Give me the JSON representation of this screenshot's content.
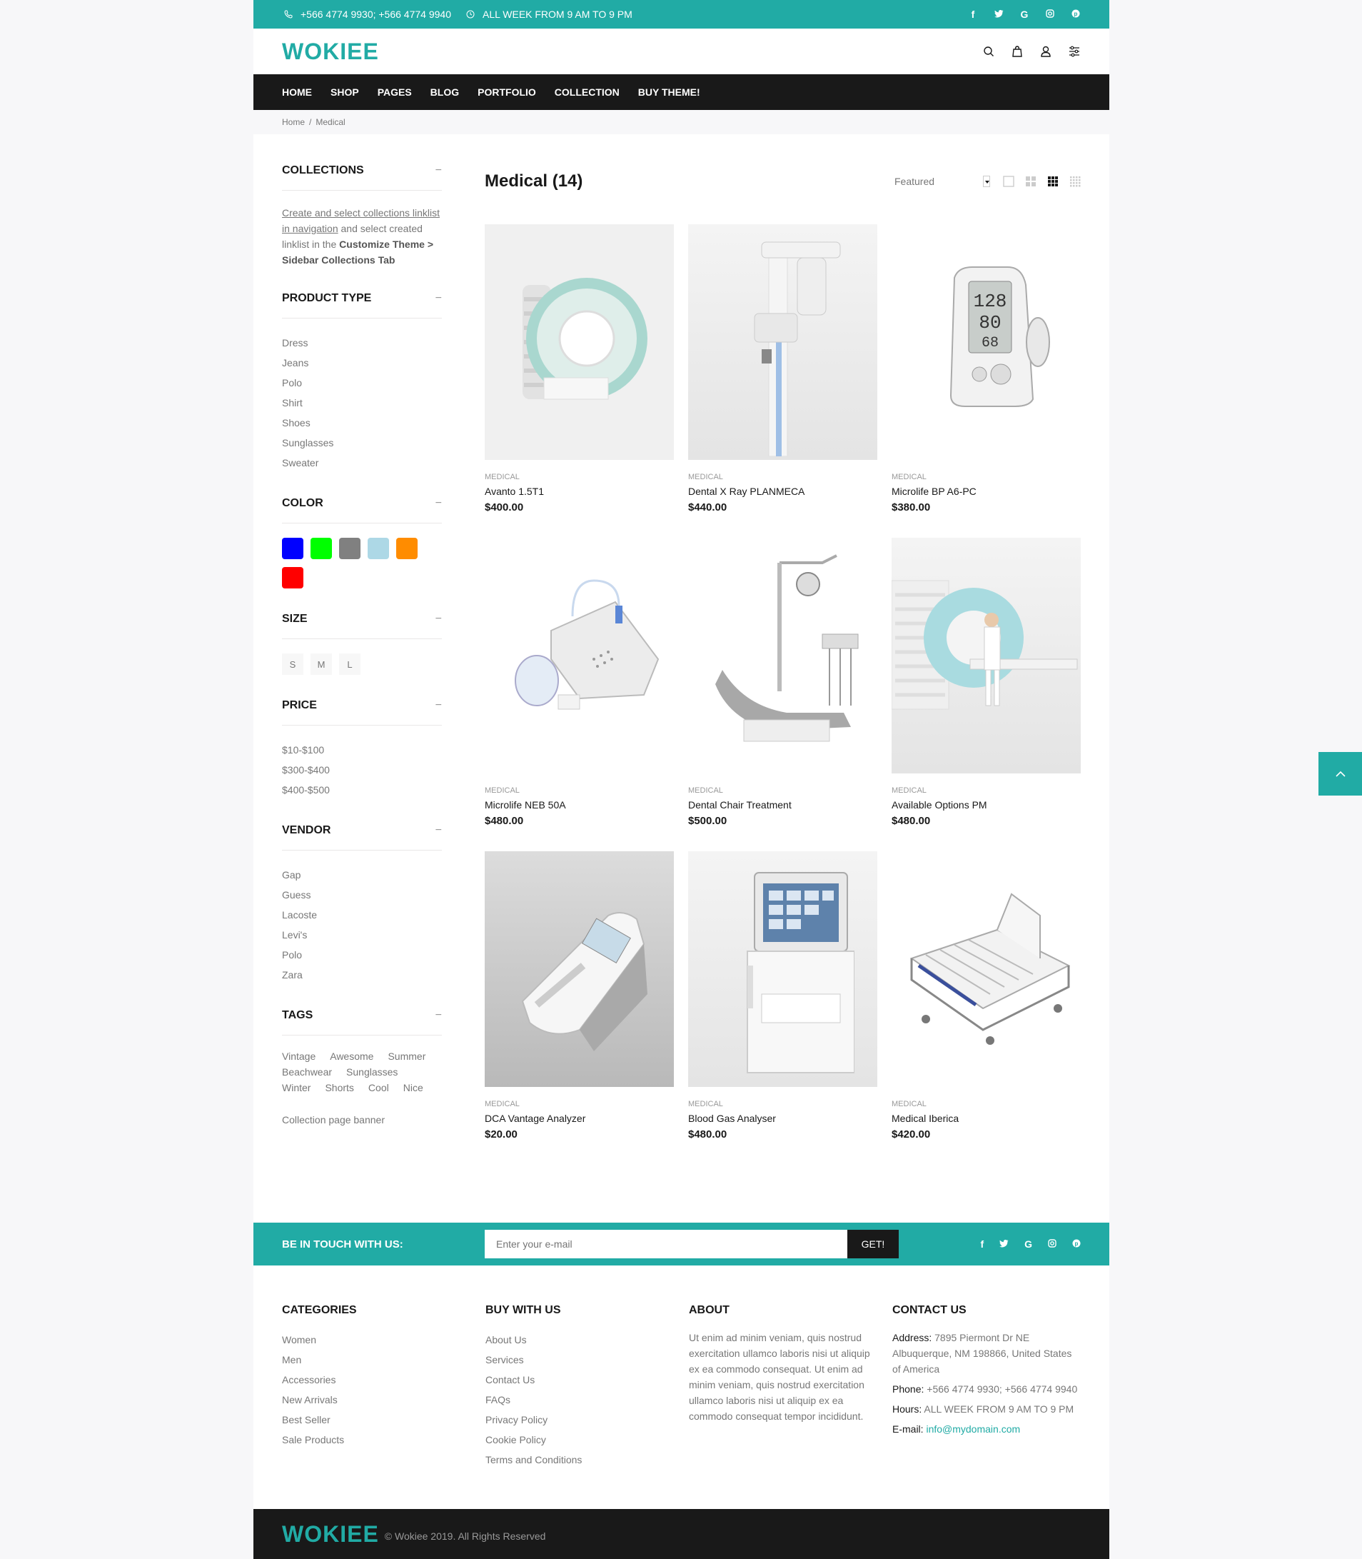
{
  "topbar": {
    "phone": "+566 4774 9930; +566 4774 9940",
    "hours": "ALL WEEK FROM 9 AM TO 9 PM",
    "social": [
      "f",
      "t",
      "G",
      "ig",
      "p"
    ]
  },
  "header": {
    "logo": "WOKIEE",
    "tools": [
      "search-icon",
      "bag-icon",
      "user-icon",
      "settings-icon"
    ]
  },
  "nav": [
    "HOME",
    "SHOP",
    "PAGES",
    "BLOG",
    "PORTFOLIO",
    "COLLECTION",
    "BUY THEME!"
  ],
  "breadcrumb": {
    "home": "Home",
    "separator": "/",
    "current": "Medical"
  },
  "sidebar": {
    "collections": {
      "title": "COLLECTIONS",
      "link_text": "Create and select collections linklist in navigation",
      "text1": " and select created linklist in the ",
      "bold": "Customize Theme > Sidebar Collections Tab"
    },
    "product_type": {
      "title": "PRODUCT TYPE",
      "items": [
        "Dress",
        "Jeans",
        "Polo",
        "Shirt",
        "Shoes",
        "Sunglasses",
        "Sweater"
      ]
    },
    "color": {
      "title": "COLOR",
      "swatches": [
        "#0000ff",
        "#00ff00",
        "#808080",
        "#add8e6",
        "#ff8c00",
        "#ff0000"
      ]
    },
    "size": {
      "title": "SIZE",
      "items": [
        "S",
        "M",
        "L"
      ]
    },
    "price": {
      "title": "PRICE",
      "items": [
        "$10-$100",
        "$300-$400",
        "$400-$500"
      ]
    },
    "vendor": {
      "title": "VENDOR",
      "items": [
        "Gap",
        "Guess",
        "Lacoste",
        "Levi's",
        "Polo",
        "Zara"
      ]
    },
    "tags": {
      "title": "TAGS",
      "items": [
        "Vintage",
        "Awesome",
        "Summer",
        "Beachwear",
        "Sunglasses",
        "Winter",
        "Shorts",
        "Cool",
        "Nice"
      ]
    },
    "toggle": "−",
    "banner": "Collection page banner"
  },
  "main": {
    "title": "Medical (14)",
    "sort": "Featured",
    "products": [
      {
        "category": "MEDICAL",
        "name": "Avanto 1.5T1",
        "price": "$400.00",
        "icon": "mri-scanner"
      },
      {
        "category": "MEDICAL",
        "name": "Dental X Ray PLANMECA",
        "price": "$440.00",
        "icon": "xray-column"
      },
      {
        "category": "MEDICAL",
        "name": "Microlife BP A6-PC",
        "price": "$380.00",
        "icon": "bp-monitor"
      },
      {
        "category": "MEDICAL",
        "name": "Microlife NEB 50A",
        "price": "$480.00",
        "icon": "nebulizer"
      },
      {
        "category": "MEDICAL",
        "name": "Dental Chair Treatment",
        "price": "$500.00",
        "icon": "dental-chair"
      },
      {
        "category": "MEDICAL",
        "name": "Available Options PM",
        "price": "$480.00",
        "icon": "mri-room"
      },
      {
        "category": "MEDICAL",
        "name": "DCA Vantage Analyzer",
        "price": "$20.00",
        "icon": "analyzer"
      },
      {
        "category": "MEDICAL",
        "name": "Blood Gas Analyser",
        "price": "$480.00",
        "icon": "blood-gas"
      },
      {
        "category": "MEDICAL",
        "name": "Medical Iberica",
        "price": "$420.00",
        "icon": "hospital-bed"
      }
    ]
  },
  "newsletter": {
    "title": "BE IN TOUCH WITH US:",
    "placeholder": "Enter your e-mail",
    "button": "GET!"
  },
  "footer": {
    "categories": {
      "title": "CATEGORIES",
      "items": [
        "Women",
        "Men",
        "Accessories",
        "New Arrivals",
        "Best Seller",
        "Sale Products"
      ]
    },
    "buy": {
      "title": "BUY WITH US",
      "items": [
        "About Us",
        "Services",
        "Contact Us",
        "FAQs",
        "Privacy Policy",
        "Cookie Policy",
        "Terms and Conditions"
      ]
    },
    "about": {
      "title": "ABOUT",
      "text": "Ut enim ad minim veniam, quis nostrud exercitation ullamco laboris nisi ut aliquip ex ea commodo consequat. Ut enim ad minim veniam, quis nostrud exercitation ullamco laboris nisi ut aliquip ex ea commodo consequat tempor incididunt."
    },
    "contact": {
      "title": "CONTACT US",
      "address_label": "Address:",
      "address": " 7895 Piermont Dr NE Albuquerque, NM 198866, United States of America",
      "phone_label": "Phone:",
      "phone": " +566 4774 9930; +566 4774 9940",
      "hours_label": "Hours:",
      "hours": " ALL WEEK FROM 9 AM TO 9 PM",
      "email_label": "E-mail:",
      "email": "info@mydomain.com"
    }
  },
  "bottom": {
    "logo": "WOKIEE",
    "copyright": "© Wokiee 2019. All Rights Reserved"
  },
  "colors": {
    "accent": "#21aba5",
    "dark": "#191919"
  }
}
